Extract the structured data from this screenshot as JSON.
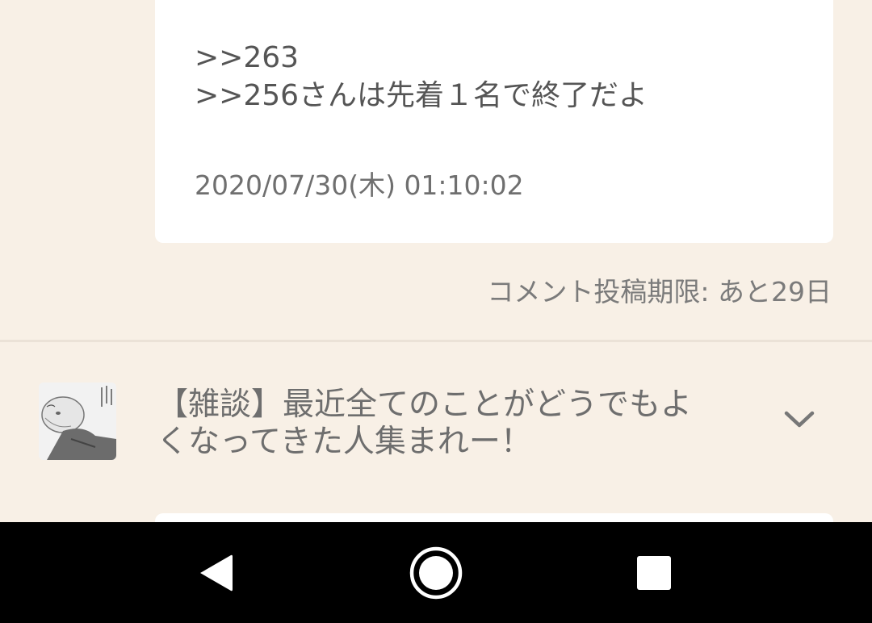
{
  "comment": {
    "lines": ">>263\n>>256さんは先着１名で終了だよ",
    "date": "2020/07/30(木) 01:10:02"
  },
  "deadline_text": "コメント投稿期限: あと29日",
  "thread": {
    "title": "【雑談】最近全てのことがどうでもよくなってきた人集まれー！"
  },
  "colors": {
    "background": "#f8f0e6",
    "card": "#ffffff",
    "navbar": "#000000"
  },
  "icons": {
    "expand": "chevron-down-icon",
    "back": "back-triangle-icon",
    "home": "home-circle-icon",
    "recents": "recents-square-icon"
  }
}
